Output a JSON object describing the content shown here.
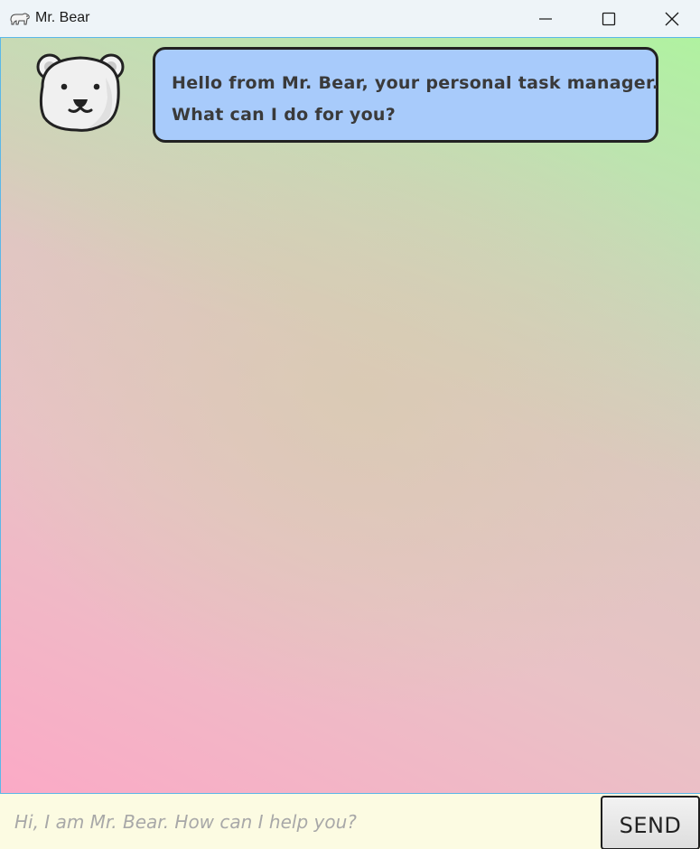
{
  "window": {
    "title": "Mr. Bear",
    "app_icon": "polar-bear-icon",
    "controls": {
      "minimize_icon": "minimize-icon",
      "maximize_icon": "maximize-icon",
      "close_icon": "close-icon"
    }
  },
  "chat": {
    "messages": [
      {
        "sender": "bot",
        "avatar_icon": "polar-bear-avatar-icon",
        "lines": [
          "Hello from Mr. Bear, your personal task manager.",
          "What can I do for you?"
        ]
      }
    ]
  },
  "input": {
    "placeholder": "Hi, I am Mr. Bear. How can I help you?",
    "value": ""
  },
  "send_button": {
    "label": "SEND"
  },
  "colors": {
    "bubble_background": "#a8cbfb",
    "input_background": "#fcfbe2",
    "window_border": "#5bb8e8",
    "gradient_pink": "#fbaac6",
    "gradient_green": "#b0f2a0"
  }
}
